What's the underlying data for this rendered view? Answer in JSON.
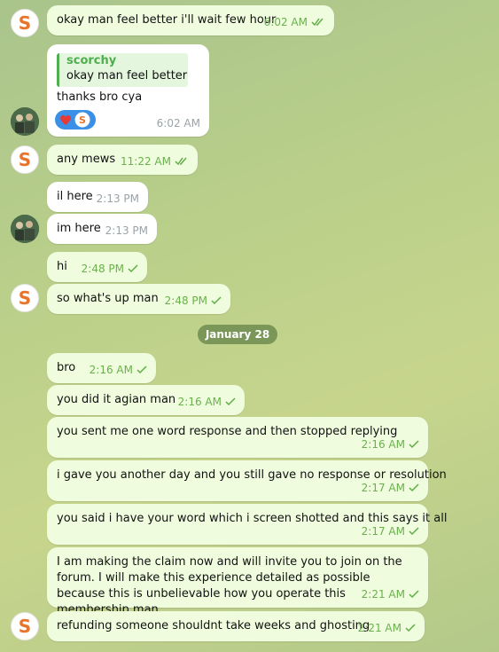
{
  "date_divider": "January 28",
  "messages": [
    {
      "text": "okay man feel better i'll wait few hour",
      "time": "6:02 AM",
      "status": "read"
    },
    {
      "reply_name": "scorchy",
      "reply_text": "okay man feel better i'l...",
      "text": "thanks bro cya",
      "time": "6:02 AM",
      "reaction": "heart-icon"
    },
    {
      "text": "any mews",
      "time": "11:22 AM",
      "status": "read"
    },
    {
      "text": "il here",
      "time": "2:13 PM"
    },
    {
      "text": "im here",
      "time": "2:13 PM"
    },
    {
      "text": "hi",
      "time": "2:48 PM",
      "status": "sent"
    },
    {
      "text": "so what's up man",
      "time": "2:48 PM",
      "status": "sent"
    },
    {
      "text": "bro",
      "time": "2:16 AM",
      "status": "sent"
    },
    {
      "text": "you did it agian man",
      "time": "2:16 AM",
      "status": "sent"
    },
    {
      "text": "you sent me one word response and then stopped replying",
      "time": "2:16 AM",
      "status": "sent"
    },
    {
      "text": "i gave you another day and you still gave no response or resolution",
      "time": "2:17 AM",
      "status": "sent"
    },
    {
      "text": "you said i have your word which i screen shotted and this says it all",
      "time": "2:17 AM",
      "status": "sent"
    },
    {
      "text": "I am making the claim now and will invite you to join on the forum. I will make this experience detailed as possible because this is unbelievable how you operate this membership man",
      "time": "2:21 AM",
      "status": "sent"
    },
    {
      "text": "refunding someone shouldnt take weeks and ghosting",
      "time": "2:21 AM",
      "status": "sent"
    }
  ],
  "colors": {
    "accent": "#4fae4e",
    "bubble_out": "#effdde",
    "bubble_in": "#ffffff",
    "date_pill": "#6e8c50"
  }
}
